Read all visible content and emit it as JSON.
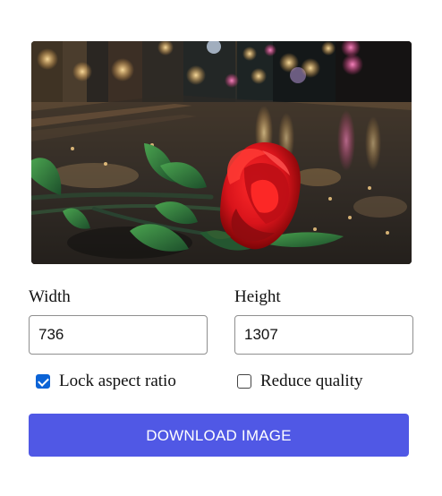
{
  "image": {
    "description_icon": "rose-photo",
    "colors": {
      "rose": "#d9141b",
      "leaf": "#2c6b35",
      "street": "#2d2b28",
      "light_warm": "#f1b65f",
      "light_pink": "#ff74b2"
    }
  },
  "form": {
    "width": {
      "label": "Width",
      "value": "736"
    },
    "height": {
      "label": "Height",
      "value": "1307"
    },
    "lock_aspect_ratio": {
      "label": "Lock aspect ratio",
      "checked": true
    },
    "reduce_quality": {
      "label": "Reduce quality",
      "checked": false
    },
    "download_button": {
      "label": "DOWNLOAD IMAGE",
      "color": "#5058e5"
    }
  }
}
